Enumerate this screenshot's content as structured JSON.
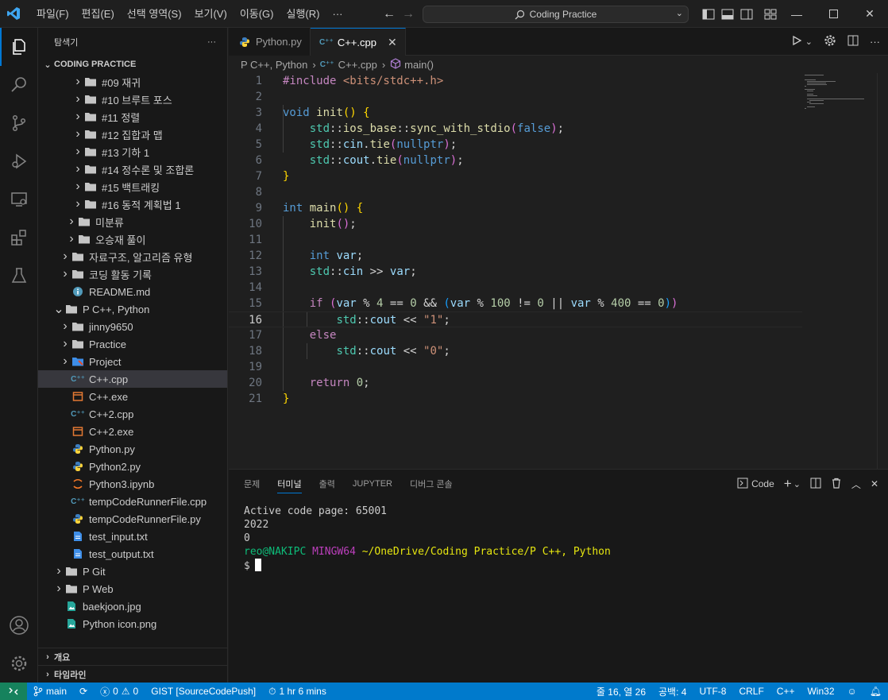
{
  "titlebar": {
    "menu": [
      "파일(F)",
      "편집(E)",
      "선택 영역(S)",
      "보기(V)",
      "이동(G)",
      "실행(R)",
      "···"
    ],
    "search": "Coding Practice"
  },
  "sidebar": {
    "header": "탐색기",
    "more": "···",
    "root": "CODING PRACTICE",
    "items": [
      {
        "label": "#09 재귀",
        "indent": 3,
        "chevron": true,
        "icon": "folder"
      },
      {
        "label": "#10 브루트 포스",
        "indent": 3,
        "chevron": true,
        "icon": "folder"
      },
      {
        "label": "#11 정렬",
        "indent": 3,
        "chevron": true,
        "icon": "folder"
      },
      {
        "label": "#12 집합과 맵",
        "indent": 3,
        "chevron": true,
        "icon": "folder"
      },
      {
        "label": "#13 기하 1",
        "indent": 3,
        "chevron": true,
        "icon": "folder"
      },
      {
        "label": "#14 정수론 및 조합론",
        "indent": 3,
        "chevron": true,
        "icon": "folder"
      },
      {
        "label": "#15 백트래킹",
        "indent": 3,
        "chevron": true,
        "icon": "folder"
      },
      {
        "label": "#16 동적 계획법 1",
        "indent": 3,
        "chevron": true,
        "icon": "folder"
      },
      {
        "label": "미분류",
        "indent": 2,
        "chevron": true,
        "icon": "folder"
      },
      {
        "label": "오승재 풀이",
        "indent": 2,
        "chevron": true,
        "icon": "folder"
      },
      {
        "label": "자료구조, 알고리즘 유형",
        "indent": 1,
        "chevron": true,
        "icon": "folder"
      },
      {
        "label": "코딩 활동 기록",
        "indent": 1,
        "chevron": true,
        "icon": "folder"
      },
      {
        "label": "README.md",
        "indent": 1,
        "chevron": false,
        "icon": "info"
      },
      {
        "label": "P C++, Python",
        "indent": 0,
        "chevron": true,
        "open": true,
        "icon": "folder-open"
      },
      {
        "label": "jinny9650",
        "indent": 1,
        "chevron": true,
        "icon": "folder"
      },
      {
        "label": "Practice",
        "indent": 1,
        "chevron": true,
        "icon": "folder"
      },
      {
        "label": "Project",
        "indent": 1,
        "chevron": true,
        "icon": "folder-project"
      },
      {
        "label": "C++.cpp",
        "indent": 1,
        "chevron": false,
        "icon": "cpp",
        "selected": true
      },
      {
        "label": "C++.exe",
        "indent": 1,
        "chevron": false,
        "icon": "exe"
      },
      {
        "label": "C++2.cpp",
        "indent": 1,
        "chevron": false,
        "icon": "cpp"
      },
      {
        "label": "C++2.exe",
        "indent": 1,
        "chevron": false,
        "icon": "exe"
      },
      {
        "label": "Python.py",
        "indent": 1,
        "chevron": false,
        "icon": "python"
      },
      {
        "label": "Python2.py",
        "indent": 1,
        "chevron": false,
        "icon": "python"
      },
      {
        "label": "Python3.ipynb",
        "indent": 1,
        "chevron": false,
        "icon": "jupyter"
      },
      {
        "label": "tempCodeRunnerFile.cpp",
        "indent": 1,
        "chevron": false,
        "icon": "cpp"
      },
      {
        "label": "tempCodeRunnerFile.py",
        "indent": 1,
        "chevron": false,
        "icon": "python"
      },
      {
        "label": "test_input.txt",
        "indent": 1,
        "chevron": false,
        "icon": "text"
      },
      {
        "label": "test_output.txt",
        "indent": 1,
        "chevron": false,
        "icon": "text"
      },
      {
        "label": "P Git",
        "indent": 0,
        "chevron": true,
        "icon": "folder"
      },
      {
        "label": "P Web",
        "indent": 0,
        "chevron": true,
        "icon": "folder"
      },
      {
        "label": "baekjoon.jpg",
        "indent": 0,
        "chevron": false,
        "icon": "image"
      },
      {
        "label": "Python icon.png",
        "indent": 0,
        "chevron": false,
        "icon": "image"
      }
    ],
    "outline": "개요",
    "timeline": "타임라인"
  },
  "tabs": [
    {
      "label": "Python.py",
      "icon": "python",
      "active": false
    },
    {
      "label": "C++.cpp",
      "icon": "cpp",
      "active": true
    }
  ],
  "breadcrumb": {
    "folder": "P C++, Python",
    "file": "C++.cpp",
    "symbol": "main()"
  },
  "editor": {
    "current_line": 16,
    "lines": [
      [
        [
          "t-pre",
          "#include "
        ],
        [
          "t-str",
          "<bits/stdc++.h>"
        ]
      ],
      [],
      [
        [
          "t-kw",
          "void "
        ],
        [
          "t-fn",
          "init"
        ],
        [
          "t-br1",
          "() {"
        ]
      ],
      [
        [
          "",
          "    "
        ],
        [
          "t-ns",
          "std"
        ],
        [
          "t-op",
          "::"
        ],
        [
          "t-fn",
          "ios_base"
        ],
        [
          "t-op",
          "::"
        ],
        [
          "t-fn",
          "sync_with_stdio"
        ],
        [
          "t-br2",
          "("
        ],
        [
          "t-kw",
          "false"
        ],
        [
          "t-br2",
          ")"
        ],
        [
          "t-op",
          ";"
        ]
      ],
      [
        [
          "",
          "    "
        ],
        [
          "t-ns",
          "std"
        ],
        [
          "t-op",
          "::"
        ],
        [
          "t-var",
          "cin"
        ],
        [
          "t-op",
          "."
        ],
        [
          "t-fn",
          "tie"
        ],
        [
          "t-br2",
          "("
        ],
        [
          "t-kw",
          "nullptr"
        ],
        [
          "t-br2",
          ")"
        ],
        [
          "t-op",
          ";"
        ]
      ],
      [
        [
          "",
          "    "
        ],
        [
          "t-ns",
          "std"
        ],
        [
          "t-op",
          "::"
        ],
        [
          "t-var",
          "cout"
        ],
        [
          "t-op",
          "."
        ],
        [
          "t-fn",
          "tie"
        ],
        [
          "t-br2",
          "("
        ],
        [
          "t-kw",
          "nullptr"
        ],
        [
          "t-br2",
          ")"
        ],
        [
          "t-op",
          ";"
        ]
      ],
      [
        [
          "t-br1",
          "}"
        ]
      ],
      [],
      [
        [
          "t-kw",
          "int "
        ],
        [
          "t-fn",
          "main"
        ],
        [
          "t-br1",
          "() {"
        ]
      ],
      [
        [
          "",
          "    "
        ],
        [
          "t-fn",
          "init"
        ],
        [
          "t-br2",
          "()"
        ],
        [
          "t-op",
          ";"
        ]
      ],
      [],
      [
        [
          "",
          "    "
        ],
        [
          "t-kw",
          "int "
        ],
        [
          "t-var",
          "var"
        ],
        [
          "t-op",
          ";"
        ]
      ],
      [
        [
          "",
          "    "
        ],
        [
          "t-ns",
          "std"
        ],
        [
          "t-op",
          "::"
        ],
        [
          "t-var",
          "cin"
        ],
        [
          "t-op",
          " >> "
        ],
        [
          "t-var",
          "var"
        ],
        [
          "t-op",
          ";"
        ]
      ],
      [],
      [
        [
          "",
          "    "
        ],
        [
          "t-ctl",
          "if "
        ],
        [
          "t-br2",
          "("
        ],
        [
          "t-var",
          "var"
        ],
        [
          "t-op",
          " % "
        ],
        [
          "t-num",
          "4"
        ],
        [
          "t-op",
          " == "
        ],
        [
          "t-num",
          "0"
        ],
        [
          "t-op",
          " && "
        ],
        [
          "t-br3",
          "("
        ],
        [
          "t-var",
          "var"
        ],
        [
          "t-op",
          " % "
        ],
        [
          "t-num",
          "100"
        ],
        [
          "t-op",
          " != "
        ],
        [
          "t-num",
          "0"
        ],
        [
          "t-op",
          " || "
        ],
        [
          "t-var",
          "var"
        ],
        [
          "t-op",
          " % "
        ],
        [
          "t-num",
          "400"
        ],
        [
          "t-op",
          " == "
        ],
        [
          "t-num",
          "0"
        ],
        [
          "t-br3",
          ")"
        ],
        [
          "t-br2",
          ")"
        ]
      ],
      [
        [
          "",
          "        "
        ],
        [
          "t-ns",
          "std"
        ],
        [
          "t-op",
          "::"
        ],
        [
          "t-var",
          "cout"
        ],
        [
          "t-op",
          " << "
        ],
        [
          "t-str",
          "\"1\""
        ],
        [
          "t-op",
          ";"
        ]
      ],
      [
        [
          "",
          "    "
        ],
        [
          "t-ctl",
          "else"
        ]
      ],
      [
        [
          "",
          "        "
        ],
        [
          "t-ns",
          "std"
        ],
        [
          "t-op",
          "::"
        ],
        [
          "t-var",
          "cout"
        ],
        [
          "t-op",
          " << "
        ],
        [
          "t-str",
          "\"0\""
        ],
        [
          "t-op",
          ";"
        ]
      ],
      [],
      [
        [
          "",
          "    "
        ],
        [
          "t-ctl",
          "return "
        ],
        [
          "t-num",
          "0"
        ],
        [
          "t-op",
          ";"
        ]
      ],
      [
        [
          "t-br1",
          "}"
        ]
      ]
    ]
  },
  "panel": {
    "tabs": [
      "문제",
      "터미널",
      "출력",
      "JUPYTER",
      "디버그 콘솔"
    ],
    "active_tab": 1,
    "shell": "Code",
    "terminal": {
      "line1": "Active code page: 65001",
      "line2": "2022",
      "line3": "0",
      "prompt_user": "reo@NAKIPC",
      "prompt_sys": "MINGW64",
      "prompt_path": "~/OneDrive/Coding Practice/P C++, Python",
      "prompt_sym": "$"
    }
  },
  "statusbar": {
    "branch": "main",
    "errors": "0",
    "warnings": "0",
    "gist": "GIST [SourceCodePush]",
    "time": "1 hr 6 mins",
    "position": "줄 16, 열 26",
    "spaces": "공백: 4",
    "encoding": "UTF-8",
    "eol": "CRLF",
    "language": "C++",
    "config": "Win32"
  },
  "colors": {
    "accent": "#0078d4",
    "statusbar": "#007acc",
    "remote": "#16825d"
  }
}
